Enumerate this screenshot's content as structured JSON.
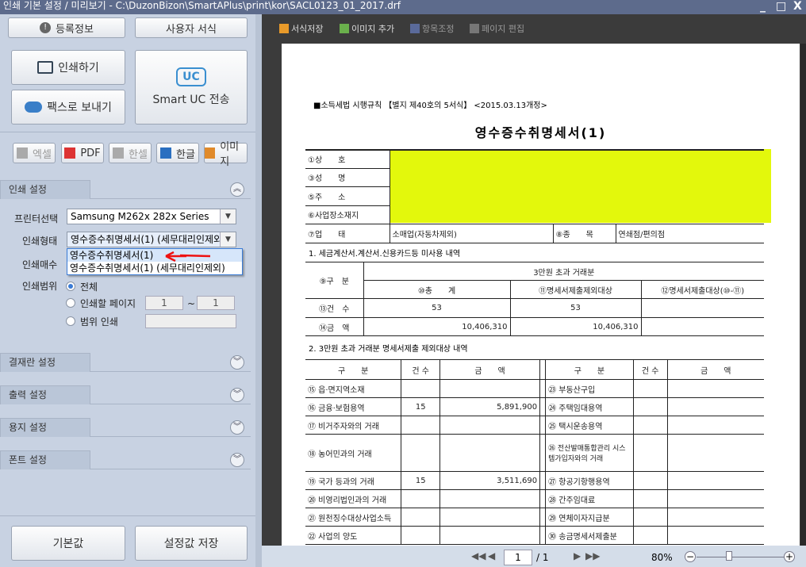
{
  "window": {
    "title": "인쇄 기본 설정 / 미리보기 -   C:\\DuzonBizon\\SmartAPlus\\print\\kor\\SACL0123_01_2017.drf",
    "min": "_",
    "max": "□",
    "close": "X"
  },
  "left": {
    "reg_info": "등록정보",
    "user_format": "사용자 서식",
    "print": "인쇄하기",
    "fax": "팩스로 보내기",
    "smart_uc": "Smart UC 전송",
    "uc_logo": "UC",
    "exports": [
      "엑셀",
      "PDF",
      "한셀",
      "한글",
      "이미지"
    ],
    "print_settings": "인쇄 설정",
    "printer_label": "프린터선택",
    "printer_value": "Samsung M262x 282x Series",
    "type_label": "인쇄형태",
    "type_value": "영수증수취명세서(1) (세무대리인제외)",
    "type_options": [
      "영수증수취명세서(1)",
      "영수증수취명세서(1) (세무대리인제외)"
    ],
    "copies_label": "인쇄매수",
    "range_label": "인쇄범위",
    "range_all": "전체",
    "range_pages": "인쇄할 페이지",
    "range_from": "1",
    "range_tilde": "~",
    "range_to": "1",
    "range_custom": "범위 인쇄",
    "sections": [
      "결재란 설정",
      "출력 설정",
      "용지 설정",
      "폰트 설정"
    ],
    "default": "기본값",
    "save": "설정값 저장"
  },
  "toolbar": [
    "서식저장",
    "이미지 추가",
    "항목조정",
    "페이지 편집"
  ],
  "doc": {
    "header": "■소득세법 시행규칙 【별지 제40호의 5서식】 <2015.03.13개정>",
    "title": "영수증수취명세서(1)",
    "info": {
      "l1": "①상　　호",
      "l2": "③성　　명",
      "l3": "⑤주　　소",
      "l4": "⑥사업장소재지",
      "l5": "⑦업　　태",
      "v5": "소매업(자동차제외)",
      "l6": "⑧종　　목",
      "v6": "연쇄점/편의점"
    },
    "sec1": "1. 세금계산서.계산서.신용카드등 미사용 내역",
    "t1": {
      "gubun": "⑨구　분",
      "over": "3만원 초과 거래분",
      "c1": "⑩총　　계",
      "c2": "⑪명세서제출제외대상",
      "c3": "⑫명세서제출대상(⑩-⑪)",
      "r1": "⑬건　수",
      "r2": "⑭금　액",
      "cnt1": "53",
      "cnt2": "53",
      "amt1": "10,406,310",
      "amt2": "10,406,310"
    },
    "sec2": "2. 3만원 초과 거래분 명세서제출 제외대상 내역",
    "t2": {
      "h_gubun": "구　　분",
      "h_cnt": "건 수",
      "h_amt": "금　　액",
      "left": [
        {
          "n": "⑮ 읍·면지역소재",
          "c": "",
          "a": ""
        },
        {
          "n": "⑯ 금융·보험용역",
          "c": "15",
          "a": "5,891,900"
        },
        {
          "n": "⑰ 비거주자와의 거래",
          "c": "",
          "a": ""
        },
        {
          "n": "⑱ 농어민과의 거래",
          "c": "",
          "a": ""
        },
        {
          "n": "⑲ 국가 등과의 거래",
          "c": "15",
          "a": "3,511,690"
        },
        {
          "n": "⑳ 비영리법인과의 거래",
          "c": "",
          "a": ""
        },
        {
          "n": "㉑ 원천징수대상사업소득",
          "c": "",
          "a": ""
        },
        {
          "n": "㉒ 사업의 양도",
          "c": "",
          "a": ""
        }
      ],
      "right": [
        "㉓ 부동산구입",
        "㉔ 주택임대용역",
        "㉕ 택시운송용역",
        "㉖ 전산발매통합관리 시스템가입자와의 거래",
        "㉗ 항공기항행용역",
        "㉘ 간주임대료",
        "㉙ 연체이자지급분",
        "㉚ 송금명세서제출분"
      ]
    }
  },
  "bottom": {
    "page": "1",
    "total": "/ 1",
    "zoom": "80%"
  }
}
